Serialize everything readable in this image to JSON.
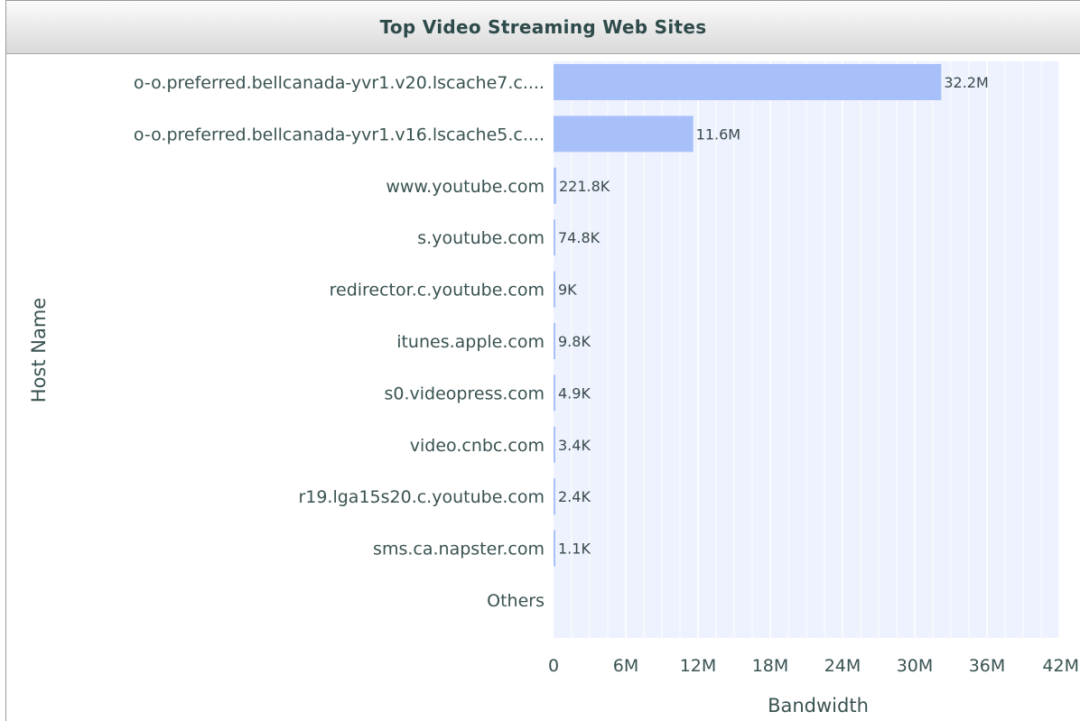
{
  "chart_data": {
    "type": "bar",
    "orientation": "horizontal",
    "title": "Top Video Streaming Web Sites",
    "xlabel": "Bandwidth",
    "ylabel": "Host Name",
    "categories": [
      "o-o.preferred.bellcanada-yvr1.v20.lscache7.c....",
      "o-o.preferred.bellcanada-yvr1.v16.lscache5.c....",
      "www.youtube.com",
      "s.youtube.com",
      "redirector.c.youtube.com",
      "itunes.apple.com",
      "s0.videopress.com",
      "video.cnbc.com",
      "r19.lga15s20.c.youtube.com",
      "sms.ca.napster.com",
      "Others"
    ],
    "values": [
      32200000,
      11600000,
      221800,
      74800,
      9000,
      9800,
      4900,
      3400,
      2400,
      1100,
      0
    ],
    "value_labels": [
      "32.2M",
      "11.6M",
      "221.8K",
      "74.8K",
      "9K",
      "9.8K",
      "4.9K",
      "3.4K",
      "2.4K",
      "1.1K",
      ""
    ],
    "xlim": [
      0,
      42000000
    ],
    "xticks": [
      0,
      6000000,
      12000000,
      18000000,
      24000000,
      30000000,
      36000000,
      42000000
    ],
    "xtick_labels": [
      "0",
      "6M",
      "12M",
      "18M",
      "24M",
      "30M",
      "36M",
      "42M"
    ],
    "grid": true,
    "colors": {
      "bar": "#a8c0fa",
      "plot_background": "#edf2fe",
      "grid": "#ffffff"
    }
  }
}
